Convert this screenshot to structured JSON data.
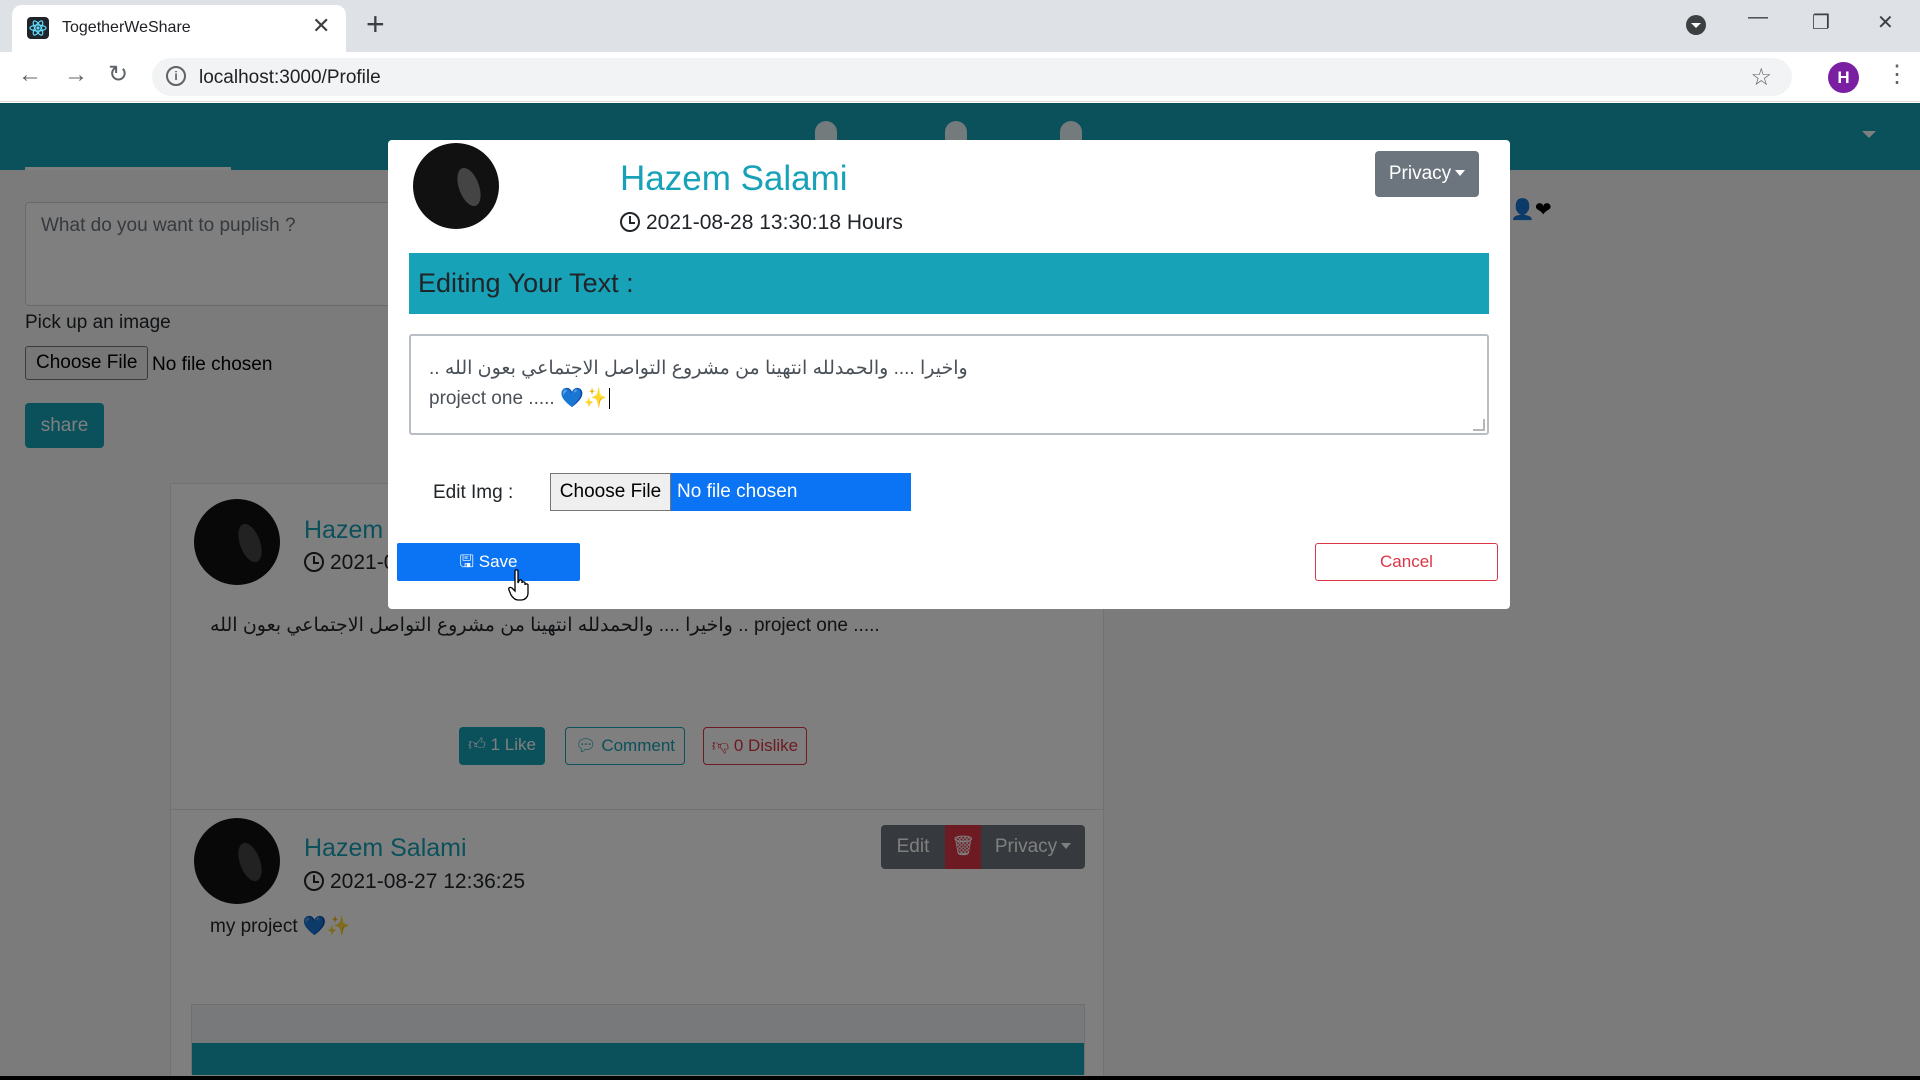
{
  "browser": {
    "tab_title": "TogetherWeShare",
    "tab_close": "✕",
    "new_tab": "+",
    "url": "localhost:3000/Profile",
    "profile_initial": "H",
    "win_minimize": "—",
    "win_restore": "❐",
    "win_close": "✕",
    "back": "←",
    "forward": "→",
    "reload": "↻",
    "star": "☆",
    "menu": "⋮"
  },
  "composer": {
    "placeholder": "What do you want to puplish ?",
    "pick_label": "Pick up an image",
    "choose_file": "Choose File",
    "no_file": "No file chosen",
    "share": "share"
  },
  "posts": [
    {
      "name": "Hazem",
      "date": "2021-0",
      "text": "واخيرا .... والحمدلله انتهينا من مشروع التواصل الاجتماعي بعون الله .. project one .....",
      "like": "1 Like",
      "comment": "Comment",
      "dislike": "0 Dislike"
    },
    {
      "name": "Hazem Salami",
      "date": "2021-08-27 12:36:25",
      "text": "my project",
      "edit": "Edit",
      "privacy": "Privacy"
    }
  ],
  "modal": {
    "name": "Hazem Salami",
    "date": "2021-08-28 13:30:18 Hours",
    "privacy": "Privacy",
    "editing_title": "Editing Your Text :",
    "text_line1": "واخيرا .... والحمدلله انتهينا من مشروع التواصل الاجتماعي بعون الله ..",
    "text_line2": "project one .....",
    "edit_img_label": "Edit Img :",
    "choose_file": "Choose File",
    "no_file": "No file chosen",
    "save": "Save",
    "cancel": "Cancel"
  },
  "colors": {
    "accent": "#17a2b8",
    "primary": "#0a74f5",
    "danger": "#dc3545",
    "secondary": "#6c757d"
  }
}
